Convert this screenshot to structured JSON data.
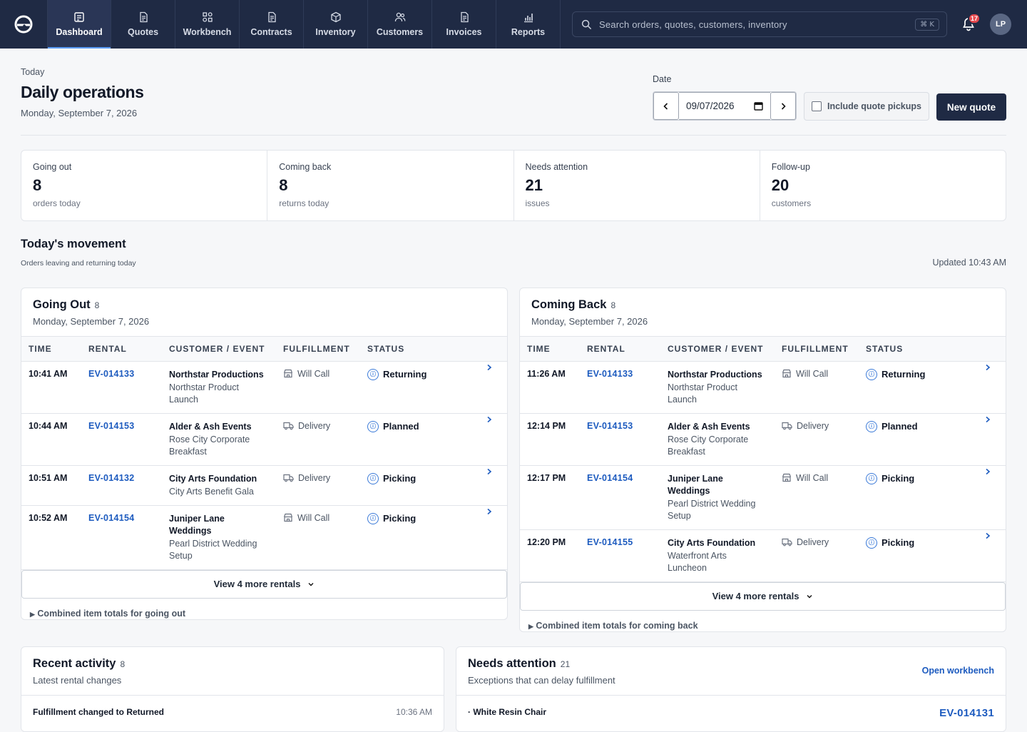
{
  "nav": {
    "items": [
      {
        "label": "Dashboard",
        "icon": "dashboard-icon",
        "active": true
      },
      {
        "label": "Quotes",
        "icon": "document-icon"
      },
      {
        "label": "Workbench",
        "icon": "workbench-icon"
      },
      {
        "label": "Contracts",
        "icon": "document-icon"
      },
      {
        "label": "Inventory",
        "icon": "box-icon"
      },
      {
        "label": "Customers",
        "icon": "users-icon"
      },
      {
        "label": "Invoices",
        "icon": "document-icon"
      },
      {
        "label": "Reports",
        "icon": "chart-icon"
      }
    ],
    "search_placeholder": "Search orders, quotes, customers, inventory",
    "search_shortcut": "⌘ K",
    "notification_count": "17",
    "avatar_initials": "LP"
  },
  "header": {
    "eyebrow": "Today",
    "title": "Daily operations",
    "date": "Monday, September 7, 2026",
    "date_label": "Date",
    "date_value": "09/07/2026",
    "include_quote_pickups": "Include quote pickups",
    "new_quote": "New quote"
  },
  "stats": [
    {
      "label": "Going out",
      "value": "8",
      "sub": "orders today"
    },
    {
      "label": "Coming back",
      "value": "8",
      "sub": "returns today"
    },
    {
      "label": "Needs attention",
      "value": "21",
      "sub": "issues"
    },
    {
      "label": "Follow-up",
      "value": "20",
      "sub": "customers"
    }
  ],
  "movement": {
    "title": "Today's movement",
    "subtitle": "Orders leaving and returning today",
    "updated": "Updated 10:43 AM",
    "columns": [
      "TIME",
      "RENTAL",
      "CUSTOMER / EVENT",
      "FULFILLMENT",
      "STATUS"
    ],
    "going_out": {
      "title": "Going Out",
      "count": "8",
      "date": "Monday, September 7, 2026",
      "rows": [
        {
          "time": "10:41 AM",
          "rental": "EV-014133",
          "customer": "Northstar Productions",
          "event": "Northstar Product Launch",
          "fulfillment": "Will Call",
          "status": "Returning"
        },
        {
          "time": "10:44 AM",
          "rental": "EV-014153",
          "customer": "Alder & Ash Events",
          "event": "Rose City Corporate Breakfast",
          "fulfillment": "Delivery",
          "status": "Planned"
        },
        {
          "time": "10:51 AM",
          "rental": "EV-014132",
          "customer": "City Arts Foundation",
          "event": "City Arts Benefit Gala",
          "fulfillment": "Delivery",
          "status": "Picking"
        },
        {
          "time": "10:52 AM",
          "rental": "EV-014154",
          "customer": "Juniper Lane Weddings",
          "event": "Pearl District Wedding Setup",
          "fulfillment": "Will Call",
          "status": "Picking"
        }
      ],
      "more": "View 4 more rentals",
      "totals": "Combined item totals for going out"
    },
    "coming_back": {
      "title": "Coming Back",
      "count": "8",
      "date": "Monday, September 7, 2026",
      "rows": [
        {
          "time": "11:26 AM",
          "rental": "EV-014133",
          "customer": "Northstar Productions",
          "event": "Northstar Product Launch",
          "fulfillment": "Will Call",
          "status": "Returning"
        },
        {
          "time": "12:14 PM",
          "rental": "EV-014153",
          "customer": "Alder & Ash Events",
          "event": "Rose City Corporate Breakfast",
          "fulfillment": "Delivery",
          "status": "Planned"
        },
        {
          "time": "12:17 PM",
          "rental": "EV-014154",
          "customer": "Juniper Lane Weddings",
          "event": "Pearl District Wedding Setup",
          "fulfillment": "Will Call",
          "status": "Picking"
        },
        {
          "time": "12:20 PM",
          "rental": "EV-014155",
          "customer": "City Arts Foundation",
          "event": "Waterfront Arts Luncheon",
          "fulfillment": "Delivery",
          "status": "Picking"
        }
      ],
      "more": "View 4 more rentals",
      "totals": "Combined item totals for coming back"
    }
  },
  "recent_activity": {
    "title": "Recent activity",
    "count": "8",
    "subtitle": "Latest rental changes",
    "first_item": "Fulfillment changed to Returned",
    "first_time": "10:36 AM"
  },
  "needs_attention": {
    "title": "Needs attention",
    "count": "21",
    "subtitle": "Exceptions that can delay fulfillment",
    "link": "Open workbench",
    "first_item": "· White Resin Chair",
    "first_ref": "EV-014131"
  }
}
